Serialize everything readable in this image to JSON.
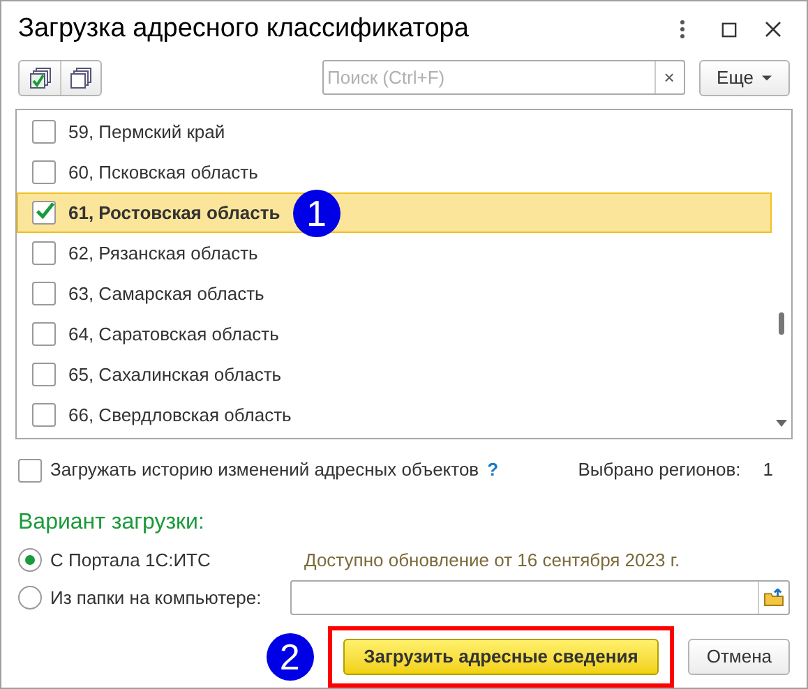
{
  "window": {
    "title": "Загрузка адресного классификатора"
  },
  "toolbar": {
    "search": {
      "placeholder": "Поиск (Ctrl+F)",
      "clear": "×"
    },
    "more_button": "Еще"
  },
  "regions": [
    {
      "label": "59, Пермский край",
      "checked": false,
      "selected": false
    },
    {
      "label": "60, Псковская область",
      "checked": false,
      "selected": false
    },
    {
      "label": "61, Ростовская область",
      "checked": true,
      "selected": true,
      "badge": "1"
    },
    {
      "label": "62, Рязанская область",
      "checked": false,
      "selected": false
    },
    {
      "label": "63, Самарская область",
      "checked": false,
      "selected": false
    },
    {
      "label": "64, Саратовская область",
      "checked": false,
      "selected": false
    },
    {
      "label": "65, Сахалинская область",
      "checked": false,
      "selected": false
    },
    {
      "label": "66, Свердловская область",
      "checked": false,
      "selected": false
    }
  ],
  "history_option": {
    "label": "Загружать историю изменений адресных объектов",
    "help": "?",
    "checked": false
  },
  "selected_count": {
    "label": "Выбрано регионов:",
    "value": "1"
  },
  "load_variant": {
    "title": "Вариант загрузки:",
    "options": [
      {
        "label": "С Портала 1С:ИТС",
        "selected": true,
        "note": "Доступно обновление от 16 сентября 2023 г."
      },
      {
        "label": "Из папки на компьютере:",
        "selected": false
      }
    ]
  },
  "buttons": {
    "load": "Загрузить адресные сведения",
    "cancel": "Отмена",
    "badge": "2"
  }
}
